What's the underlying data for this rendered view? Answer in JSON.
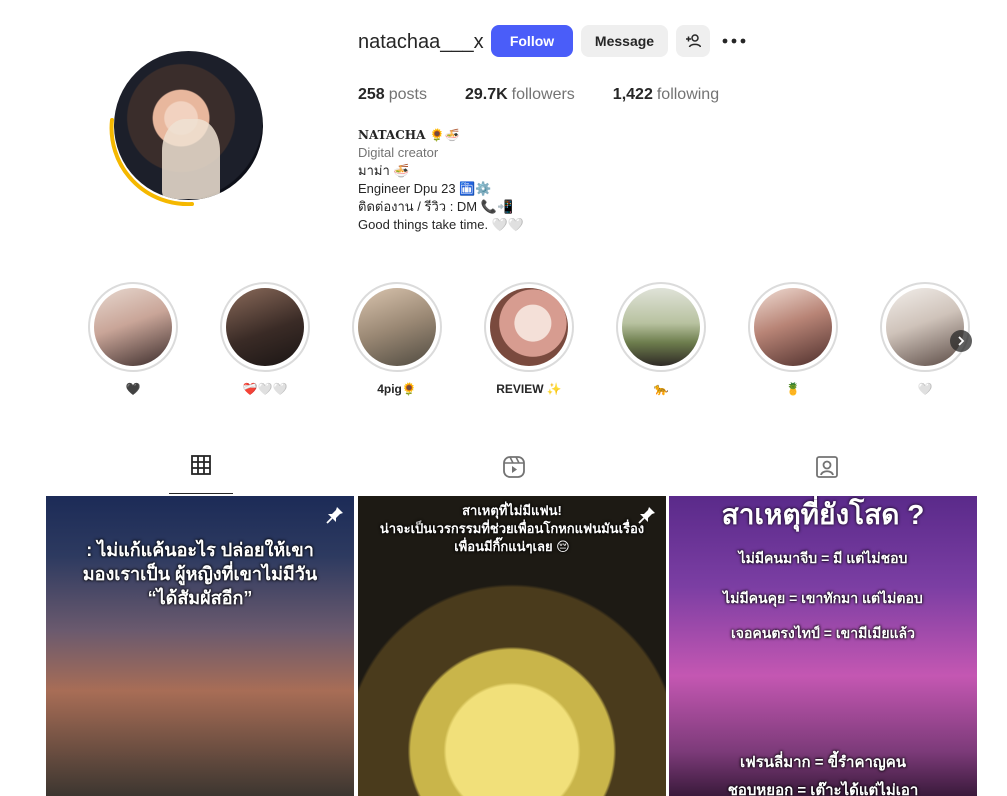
{
  "profile": {
    "username": "natachaa___x",
    "follow_label": "Follow",
    "message_label": "Message",
    "stats": {
      "posts_count": "258",
      "posts_label": "posts",
      "followers_count": "29.7K",
      "followers_label": "followers",
      "following_count": "1,422",
      "following_label": "following"
    },
    "bio": {
      "name": "NATACHA 🌻🍜",
      "category": "Digital creator",
      "lines": [
        "มาม่า 🍜",
        "Engineer Dpu 23 🛅⚙️",
        "ติดต่องาน / รีวิว : DM 📞📲",
        "Good things take time. 🤍🤍"
      ]
    }
  },
  "highlights": [
    {
      "label": "🖤",
      "color_a": "#d9c2b6",
      "color_b": "#4a3a36"
    },
    {
      "label": "❤️‍🩹🤍🤍",
      "color_a": "#6b5145",
      "color_b": "#1f1a19"
    },
    {
      "label": "4pig🌻",
      "color_a": "#c2a790",
      "color_b": "#5a5448"
    },
    {
      "label": "REVIEW ✨",
      "color_a": "#f1ddd6",
      "color_b": "#c4847a"
    },
    {
      "label": "🐆",
      "color_a": "#b8c7a2",
      "color_b": "#5b6b47"
    },
    {
      "label": "🍍",
      "color_a": "#d7b7a8",
      "color_b": "#5a3d3a"
    },
    {
      "label": "🤍",
      "color_a": "#e7dfd8",
      "color_b": "#6e5a50"
    }
  ],
  "tabs": [
    {
      "name": "posts",
      "icon": "grid-icon",
      "active": true
    },
    {
      "name": "reels",
      "icon": "reels-icon",
      "active": false
    },
    {
      "name": "tagged",
      "icon": "tagged-icon",
      "active": false
    }
  ],
  "posts": [
    {
      "text": ": ไม่แก้แค้นอะไร ปล่อยให้เขา\nมองเราเป็น ผู้หญิงที่เขาไม่มีวัน\n“ได้สัมผัสอีก”",
      "pinned": true
    },
    {
      "text": "สาเหตุที่ไม่มีแฟน!\nน่าจะเป็นเวรกรรมที่ช่วยเพื่อนโกหกแฟนมันเรื่อง\nเพื่อนมีกิ๊กแน่ๆเลย 😔",
      "pinned": true
    },
    {
      "text": "สาเหตุที่ยังโสด ?",
      "lines": [
        "ไม่มีคนมาจีบ = มี แต่ไม่ชอบ",
        "ไม่มีคนคุย = เขาทักมา แต่ไม่ตอบ",
        "เจอคนตรงไทป์ = เขามีเมียแล้ว",
        "เฟรนลี่มาก = ขี้รำคาญคน",
        "ชอบหยอก = เต๊าะได้แต่ไม่เอา"
      ],
      "pinned": false
    }
  ],
  "colors": {
    "accent": "#4a5df9",
    "story_ring_yellow": "#f5b800"
  }
}
